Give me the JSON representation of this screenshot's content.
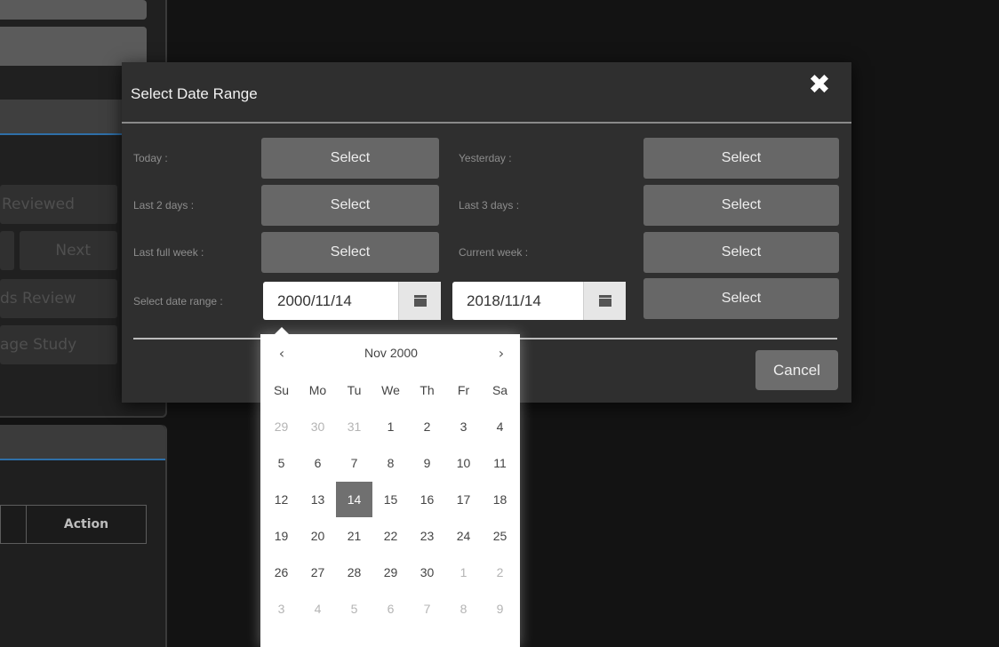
{
  "background": {
    "faded_buttons": [
      "Reviewed",
      "Next",
      "ds Review",
      "age Study"
    ],
    "table_header": "Action"
  },
  "modal": {
    "title": "Select Date Range",
    "close_icon": "close-x-icon",
    "rows": [
      {
        "left_label": "Today :",
        "left_button": "Select",
        "right_label": "Yesterday :",
        "right_button": "Select"
      },
      {
        "left_label": "Last 2 days :",
        "left_button": "Select",
        "right_label": "Last 3 days :",
        "right_button": "Select"
      },
      {
        "left_label": "Last full week :",
        "left_button": "Select",
        "right_label": "Current week :",
        "right_button": "Select"
      }
    ],
    "range_row": {
      "label": "Select date range :",
      "from_value": "2000/11/14",
      "to_value": "2018/11/14",
      "button": "Select",
      "calendar_icon": "calendar-icon"
    },
    "cancel": "Cancel"
  },
  "datepicker": {
    "prev": "‹",
    "next": "›",
    "month_label": "Nov 2000",
    "weekdays": [
      "Su",
      "Mo",
      "Tu",
      "We",
      "Th",
      "Fr",
      "Sa"
    ],
    "weeks": [
      [
        "29",
        "30",
        "31",
        "1",
        "2",
        "3",
        "4"
      ],
      [
        "5",
        "6",
        "7",
        "8",
        "9",
        "10",
        "11"
      ],
      [
        "12",
        "13",
        "14",
        "15",
        "16",
        "17",
        "18"
      ],
      [
        "19",
        "20",
        "21",
        "22",
        "23",
        "24",
        "25"
      ],
      [
        "26",
        "27",
        "28",
        "29",
        "30",
        "1",
        "2"
      ],
      [
        "3",
        "4",
        "5",
        "6",
        "7",
        "8",
        "9"
      ]
    ],
    "selected_day": "14"
  }
}
